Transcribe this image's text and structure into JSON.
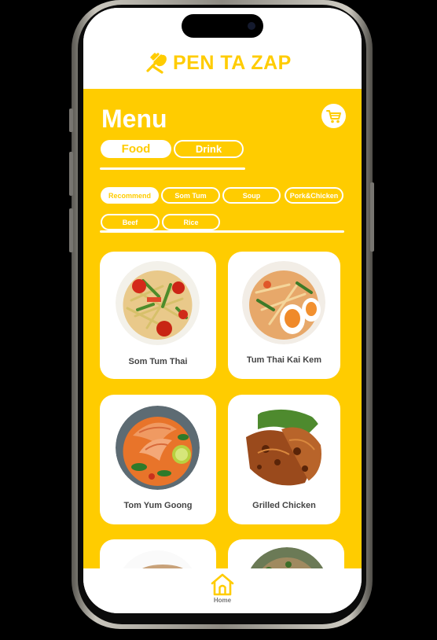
{
  "brand": {
    "name": "PEN TA ZAP",
    "logo_icon": "fork-spoon-logo-icon",
    "color": "#ffcc00"
  },
  "menu": {
    "title": "Menu",
    "cart_icon": "cart-icon",
    "tabs": [
      {
        "label": "Food",
        "selected": true
      },
      {
        "label": "Drink",
        "selected": false
      }
    ],
    "categories": [
      {
        "label": "Recommend",
        "selected": true
      },
      {
        "label": "Som Tum",
        "selected": false
      },
      {
        "label": "Soup",
        "selected": false
      },
      {
        "label": "Pork&Chicken",
        "selected": false
      },
      {
        "label": "Beef",
        "selected": false
      },
      {
        "label": "Rice",
        "selected": false
      }
    ],
    "items": [
      {
        "name": "Som Tum Thai"
      },
      {
        "name": "Tum Thai Kai Kem"
      },
      {
        "name": "Tom Yum Goong"
      },
      {
        "name": "Grilled Chicken"
      },
      {
        "name": ""
      },
      {
        "name": ""
      }
    ]
  },
  "tabbar": {
    "home_label": "Home",
    "home_icon": "home-icon"
  },
  "colors": {
    "accent": "#ffcc00",
    "background": "#000000",
    "card": "#ffffff",
    "text": "#444444"
  }
}
